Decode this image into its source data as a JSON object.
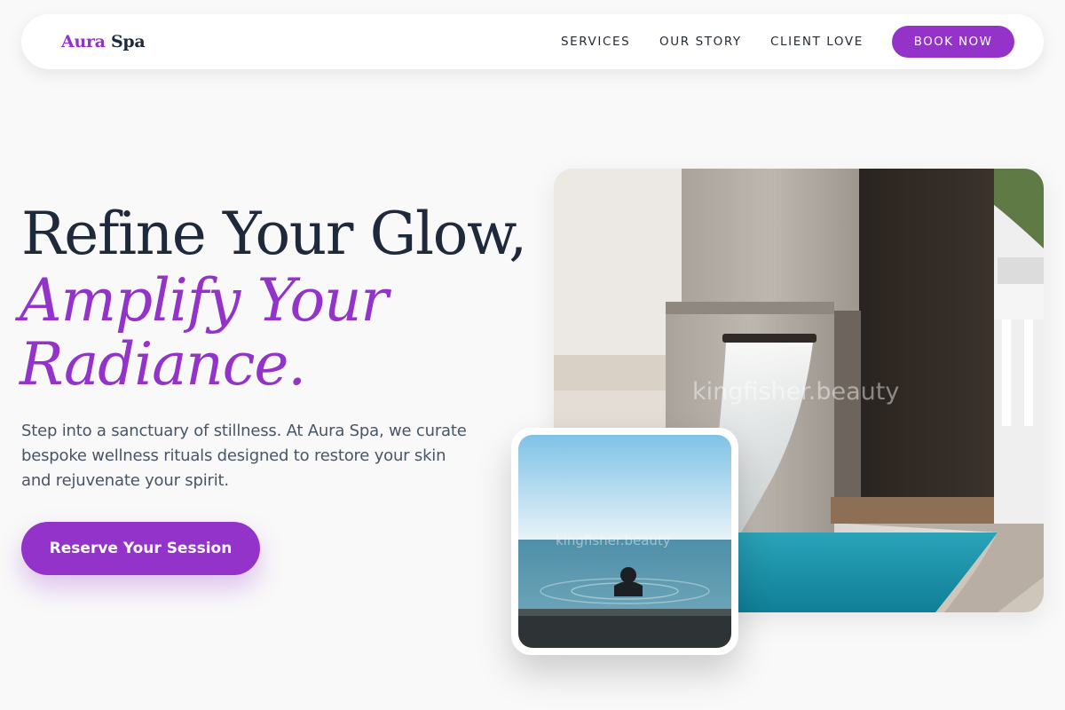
{
  "brand": {
    "first": "Aura",
    "second": "Spa"
  },
  "nav": {
    "links": [
      "SERVICES",
      "OUR STORY",
      "CLIENT LOVE"
    ],
    "cta": "BOOK NOW"
  },
  "hero": {
    "title_line1": "Refine Your Glow,",
    "title_em_line1": "Amplify Your",
    "title_em_line2": "Radiance.",
    "lede": "Step into a sanctuary of stillness. At Aura Spa, we curate bespoke wellness rituals designed to restore your skin and rejuvenate your spirit.",
    "cta": "Reserve Your Session"
  },
  "images": {
    "main_watermark": "kingfisher.beauty",
    "small_watermark": "kingfisher.beauty"
  },
  "colors": {
    "accent": "#9333c9",
    "heading": "#1e293b",
    "body": "#475569",
    "background": "#f9f9f9"
  }
}
